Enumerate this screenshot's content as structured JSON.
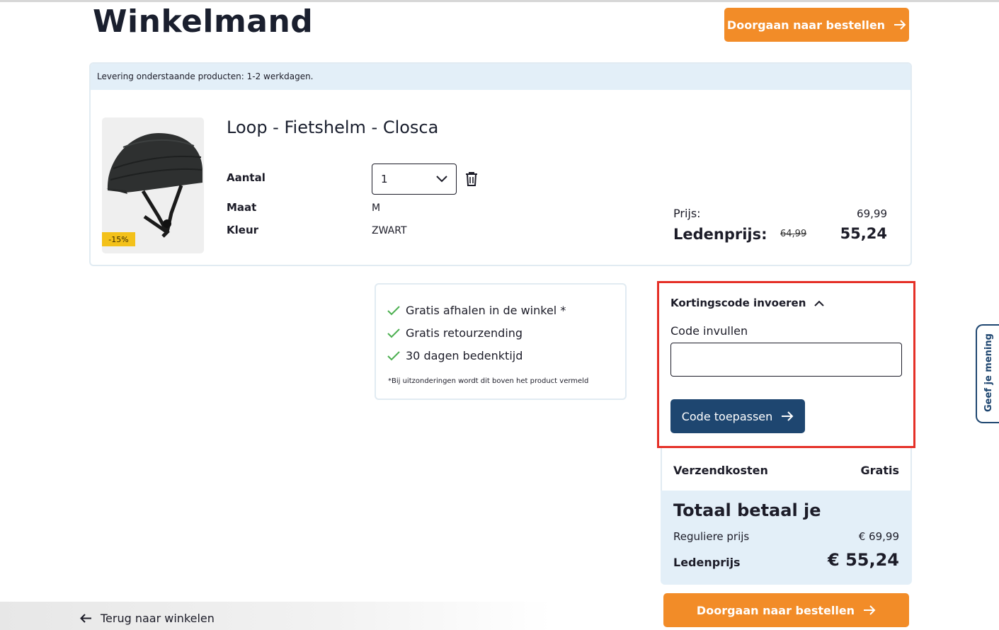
{
  "page": {
    "title": "Winkelmand"
  },
  "actions": {
    "checkout_label": "Doorgaan naar bestellen",
    "back_label": "Terug naar winkelen"
  },
  "cart": {
    "delivery_notice": "Levering onderstaande producten: 1-2 werkdagen.",
    "item": {
      "name": "Loop - Fietshelm - Closca",
      "image_icon": "bicycle-helmet",
      "discount_badge": "-15%",
      "specs": {
        "quantity_label": "Aantal",
        "quantity_value": "1",
        "size_label": "Maat",
        "size_value": "M",
        "color_label": "Kleur",
        "color_value": "ZWART"
      },
      "price_label": "Prijs:",
      "price_value": "69,99",
      "member_label": "Ledenprijs:",
      "member_old_price": "64,99",
      "member_price": "55,24"
    }
  },
  "usps": {
    "items": [
      "Gratis afhalen in de winkel *",
      "Gratis retourzending",
      "30 dagen bedenktijd"
    ],
    "note": "*Bij uitzonderingen wordt dit boven het product vermeld"
  },
  "discount": {
    "toggle_label": "Kortingscode invoeren",
    "code_label": "Code invullen",
    "code_value": "",
    "apply_label": "Code toepassen"
  },
  "summary": {
    "shipping_label": "Verzendkosten",
    "shipping_value": "Gratis",
    "total_title": "Totaal betaal je",
    "regular_label": "Reguliere prijs",
    "regular_value": "€ 69,99",
    "member_label": "Ledenprijs",
    "member_value": "€ 55,24"
  },
  "feedback": {
    "label": "Geef je mening"
  },
  "colors": {
    "accent_orange": "#f28c28",
    "navy": "#1e4670",
    "highlight_red": "#e53027",
    "badge_yellow": "#f3c11a",
    "light_blue_bg": "#e3eff8"
  }
}
